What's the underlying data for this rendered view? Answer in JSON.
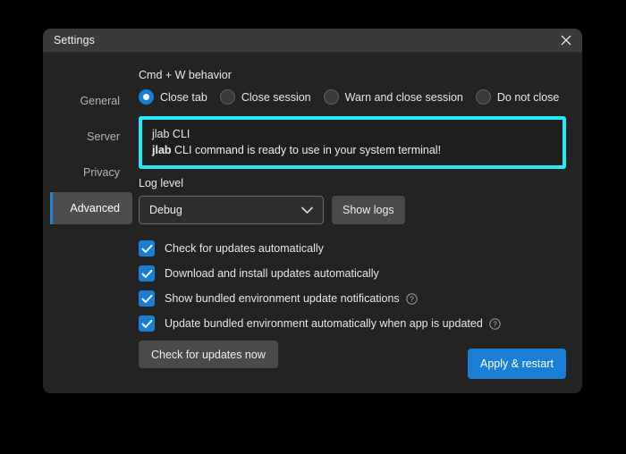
{
  "window": {
    "title": "Settings",
    "close_icon": "close-icon"
  },
  "sidebar": {
    "items": [
      {
        "label": "General",
        "active": false
      },
      {
        "label": "Server",
        "active": false
      },
      {
        "label": "Privacy",
        "active": false
      },
      {
        "label": "Advanced",
        "active": true
      }
    ]
  },
  "cmd_w": {
    "label": "Cmd + W behavior",
    "options": [
      {
        "label": "Close tab",
        "selected": true
      },
      {
        "label": "Close session",
        "selected": false
      },
      {
        "label": "Warn and close session",
        "selected": false
      },
      {
        "label": "Do not close",
        "selected": false
      }
    ]
  },
  "cli": {
    "heading": "jlab CLI",
    "message_bold": "jlab",
    "message_rest": " CLI command is ready to use in your system terminal!",
    "highlight_color": "#25e9f7"
  },
  "log_level": {
    "label": "Log level",
    "value": "Debug",
    "chevron_icon": "chevron-down-icon",
    "show_logs_label": "Show logs"
  },
  "updates": {
    "checkboxes": [
      {
        "label": "Check for updates automatically",
        "checked": true,
        "help": false
      },
      {
        "label": "Download and install updates automatically",
        "checked": true,
        "help": false
      },
      {
        "label": "Show bundled environment update notifications",
        "checked": true,
        "help": true
      },
      {
        "label": "Update bundled environment automatically when app is updated",
        "checked": true,
        "help": true
      }
    ],
    "check_now_label": "Check for updates now"
  },
  "footer": {
    "apply_label": "Apply & restart",
    "accent_color": "#1a7fd4"
  }
}
